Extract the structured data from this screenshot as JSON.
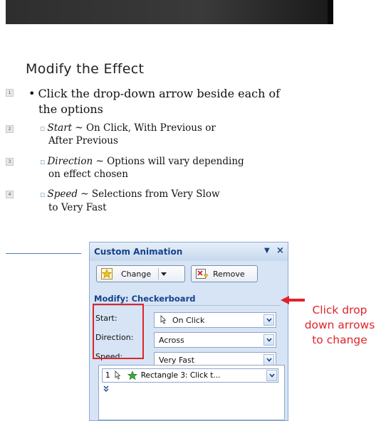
{
  "slide": {
    "title": "Modify the Effect",
    "tags": [
      "1",
      "2",
      "3",
      "4"
    ],
    "bullet_main_line1": "Click the drop-down arrow beside each of",
    "bullet_main_line2": "the options",
    "sub1_term": "Start",
    "sub1_rest": " ~ On Click, With Previous or",
    "sub1_line2": "After Previous",
    "sub2_term": "Direction",
    "sub2_rest": " ~ Options will vary depending",
    "sub2_line2": "on effect chosen",
    "sub3_term": "Speed",
    "sub3_rest": " ~ Selections from Very Slow",
    "sub3_line2": "to Very Fast"
  },
  "panel": {
    "title": "Custom Animation",
    "change_label": "Change",
    "remove_label": "Remove",
    "modify_label": "Modify: Checkerboard",
    "fields": [
      {
        "label": "Start:",
        "value": "On Click"
      },
      {
        "label": "Direction:",
        "value": "Across"
      },
      {
        "label": "Speed:",
        "value": "Very Fast"
      }
    ],
    "list_item_number": "1",
    "list_item_text": "Rectangle 3: Click t..."
  },
  "callout": {
    "text": "Click drop down arrows to change",
    "color": "#e0242a"
  },
  "colors": {
    "panel_bg": "#d6e4f5",
    "panel_title": "#15428b",
    "highlight_red": "#e0242a"
  }
}
